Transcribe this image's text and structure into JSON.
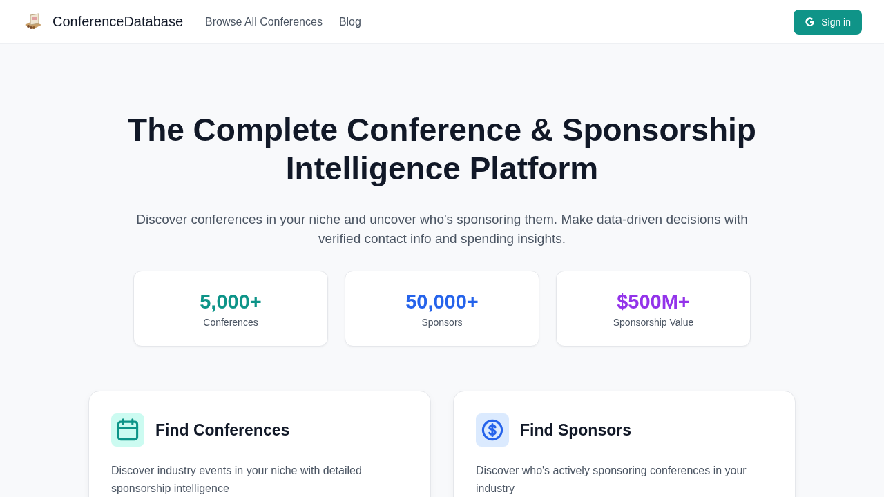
{
  "header": {
    "brand": "ConferenceDatabase",
    "nav": [
      "Browse All Conferences",
      "Blog"
    ],
    "sign_in": "Sign in"
  },
  "hero": {
    "title": "The Complete Conference & Sponsorship Intelligence Platform",
    "subtitle": "Discover conferences in your niche and uncover who's sponsoring them. Make data-driven decisions with verified contact info and spending insights."
  },
  "stats": [
    {
      "value": "5,000+",
      "label": "Conferences",
      "color": "#0d9488"
    },
    {
      "value": "50,000+",
      "label": "Sponsors",
      "color": "#2563eb"
    },
    {
      "value": "$500M+",
      "label": "Sponsorship Value",
      "color": "#9333ea"
    }
  ],
  "features": [
    {
      "kind": "calendar",
      "title": "Find Conferences",
      "description": "Discover industry events in your niche with detailed sponsorship intelligence"
    },
    {
      "kind": "dollar",
      "title": "Find Sponsors",
      "description": "Discover who's actively sponsoring conferences in your industry"
    }
  ]
}
